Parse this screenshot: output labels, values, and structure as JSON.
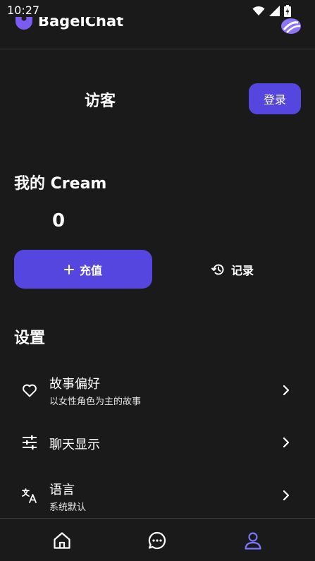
{
  "status_bar": {
    "time": "10:27",
    "icons": [
      "wifi-icon",
      "signal-icon",
      "battery-charging-icon"
    ]
  },
  "header": {
    "app_name": "BagelChat",
    "logo_icon": "bagelchat-logo-icon",
    "avatar_icon": "user-avatar-icon"
  },
  "profile": {
    "guest_label": "访客",
    "login_label": "登录"
  },
  "cream": {
    "title": "我的 Cream",
    "balance": "0",
    "recharge_label": "充值",
    "recharge_icon": "plus-icon",
    "history_label": "记录",
    "history_icon": "history-icon"
  },
  "settings": {
    "title": "设置",
    "items": [
      {
        "label": "故事偏好",
        "subtitle": "以女性角色为主的故事",
        "icon": "heart-icon"
      },
      {
        "label": "聊天显示",
        "subtitle": "",
        "icon": "sliders-icon"
      },
      {
        "label": "语言",
        "subtitle": "系统默认",
        "icon": "translate-icon"
      }
    ]
  },
  "bottom_nav": {
    "items": [
      {
        "icon": "home-icon",
        "active": false
      },
      {
        "icon": "chat-icon",
        "active": false
      },
      {
        "icon": "profile-icon",
        "active": true
      }
    ]
  },
  "colors": {
    "background": "#1a1a1a",
    "accent": "#5546e0",
    "active_nav": "#7c75ff",
    "divider": "#3a3a3a"
  }
}
